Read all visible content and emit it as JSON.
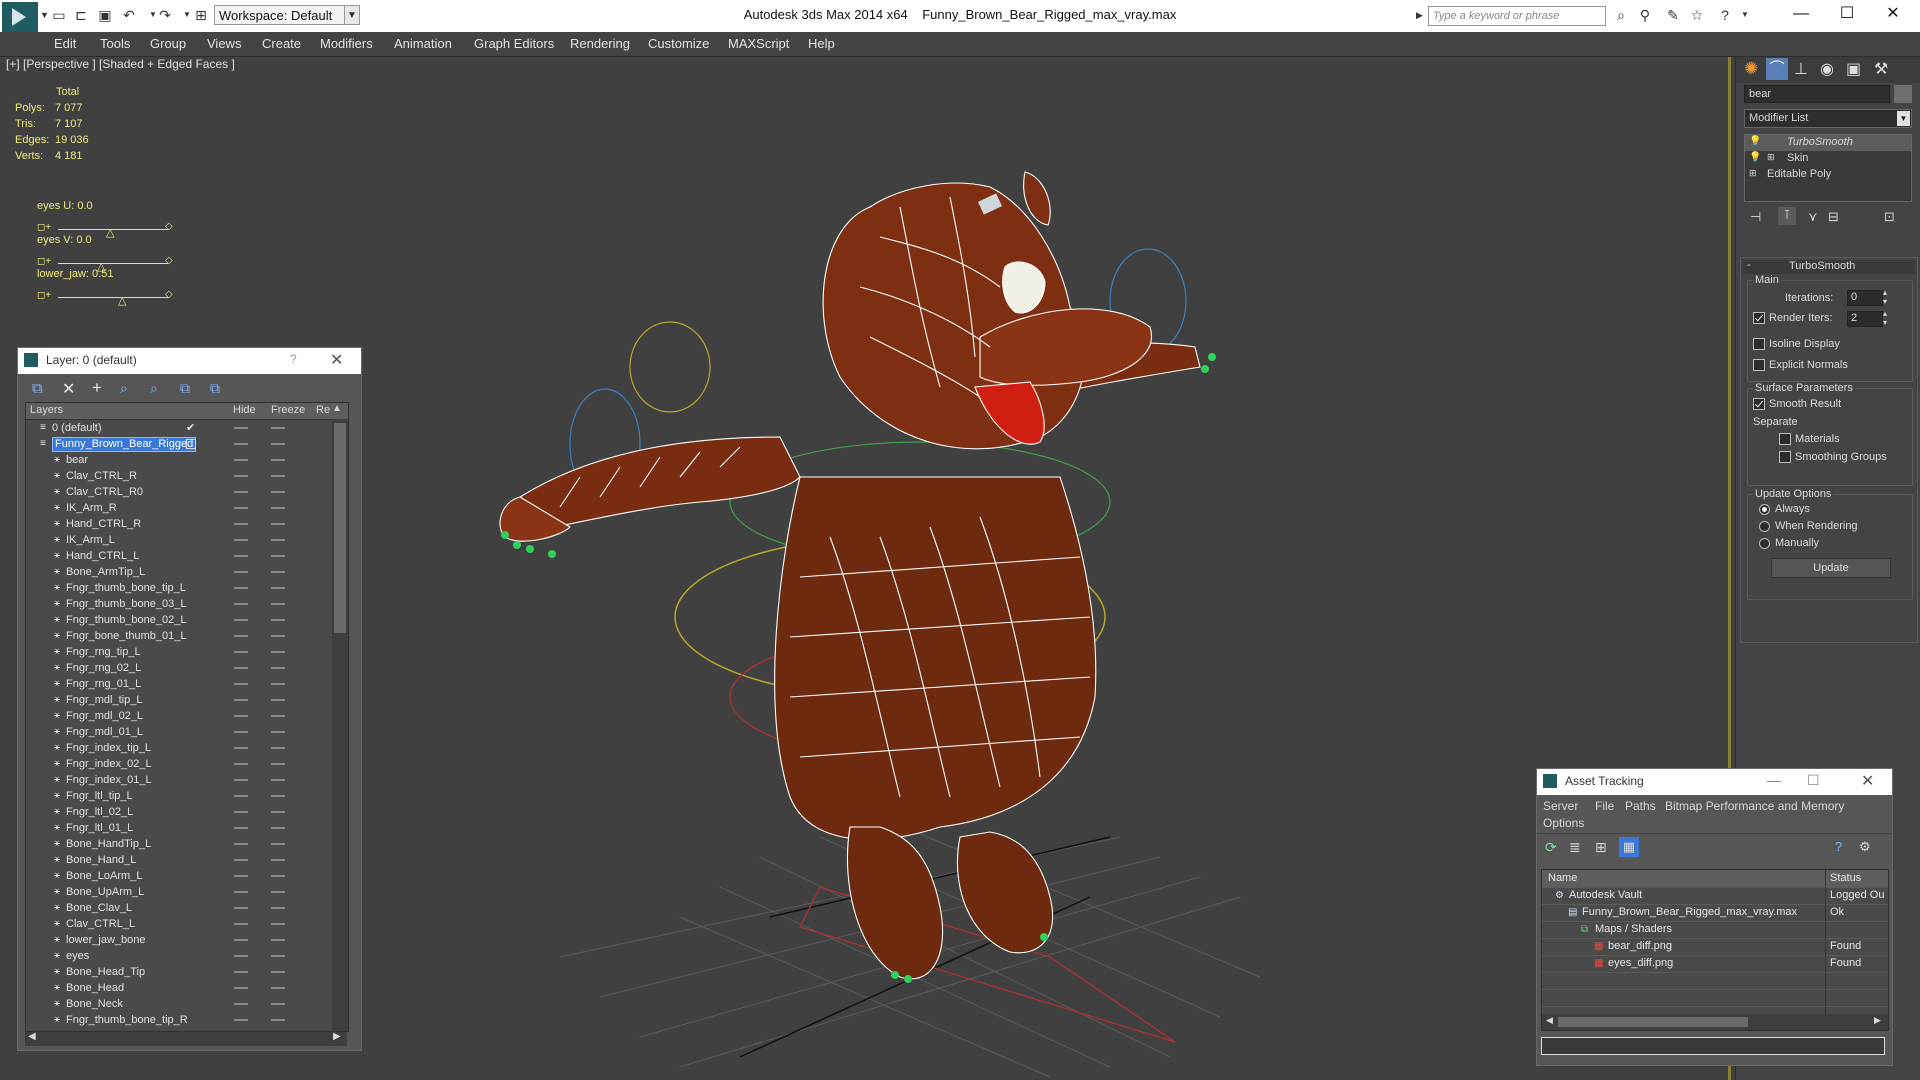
{
  "app": {
    "title": "Autodesk 3ds Max  2014 x64",
    "filename": "Funny_Brown_Bear_Rigged_max_vray.max",
    "workspace": "Workspace: Default",
    "search_placeholder": "Type a keyword or phrase"
  },
  "menu": [
    "Edit",
    "Tools",
    "Group",
    "Views",
    "Create",
    "Modifiers",
    "Animation",
    "Graph Editors",
    "Rendering",
    "Customize",
    "MAXScript",
    "Help"
  ],
  "viewport": {
    "label": "[+] [Perspective ] [Shaded + Edged Faces ]",
    "stats_header": "Total",
    "stats": [
      {
        "label": "Polys:",
        "value": "7 077"
      },
      {
        "label": "Tris:",
        "value": "7 107"
      },
      {
        "label": "Edges:",
        "value": "19 036"
      },
      {
        "label": "Verts:",
        "value": "4 181"
      }
    ],
    "sliders": [
      {
        "label": "eyes U: 0.0",
        "value": 0.0
      },
      {
        "label": "eyes V: 0.0",
        "value": 0.0
      },
      {
        "label": "lower_jaw: 0.51",
        "value": 0.51
      }
    ]
  },
  "layer_window": {
    "title": "Layer: 0 (default)",
    "help": "?",
    "columns": [
      "Layers",
      "Hide",
      "Freeze",
      "Re"
    ],
    "layers": [
      {
        "name": "0 (default)",
        "indent": 0,
        "checked": true
      },
      {
        "name": "Funny_Brown_Bear_Rigged",
        "indent": 0,
        "selected": true
      }
    ],
    "objects": [
      "bear",
      "Clav_CTRL_R",
      "Clav_CTRL_R0",
      "IK_Arm_R",
      "Hand_CTRL_R",
      "IK_Arm_L",
      "Hand_CTRL_L",
      "Bone_ArmTip_L",
      "Fngr_thumb_bone_tip_L",
      "Fngr_thumb_bone_03_L",
      "Fngr_thumb_bone_02_L",
      "Fngr_bone_thumb_01_L",
      "Fngr_rng_tip_L",
      "Fngr_rng_02_L",
      "Fngr_rng_01_L",
      "Fngr_mdl_tip_L",
      "Fngr_mdl_02_L",
      "Fngr_mdl_01_L",
      "Fngr_index_tip_L",
      "Fngr_index_02_L",
      "Fngr_index_01_L",
      "Fngr_ltl_tip_L",
      "Fngr_ltl_02_L",
      "Fngr_ltl_01_L",
      "Bone_HandTip_L",
      "Bone_Hand_L",
      "Bone_LoArm_L",
      "Bone_UpArm_L",
      "Bone_Clav_L",
      "Clav_CTRL_L",
      "lower_jaw_bone",
      "eyes",
      "Bone_Head_Tip",
      "Bone_Head",
      "Bone_Neck",
      "Fngr_thumb_bone_tip_R"
    ]
  },
  "command_panel": {
    "object_name": "bear",
    "modifier_list": "Modifier List",
    "stack": [
      "TurboSmooth",
      "Skin",
      "Editable Poly"
    ],
    "rollout_title": "TurboSmooth",
    "main_label": "Main",
    "iterations_label": "Iterations:",
    "iterations_value": "0",
    "render_iters_label": "Render Iters:",
    "render_iters_value": "2",
    "isoline": "Isoline Display",
    "explicit_normals": "Explicit Normals",
    "surface_params": "Surface Parameters",
    "smooth_result": "Smooth Result",
    "separate": "Separate",
    "materials": "Materials",
    "smoothing_groups": "Smoothing Groups",
    "update_options": "Update Options",
    "always": "Always",
    "when_rendering": "When Rendering",
    "manually": "Manually",
    "update_btn": "Update"
  },
  "asset_window": {
    "title": "Asset Tracking",
    "menu": [
      "Server",
      "File",
      "Paths",
      "Bitmap Performance and Memory"
    ],
    "menu2": "Options",
    "columns": [
      "Name",
      "Status"
    ],
    "rows": [
      {
        "name": "Autodesk Vault",
        "status": "Logged Ou",
        "indent": 1
      },
      {
        "name": "Funny_Brown_Bear_Rigged_max_vray.max",
        "status": "Ok",
        "indent": 2
      },
      {
        "name": "Maps / Shaders",
        "status": "",
        "indent": 3
      },
      {
        "name": "bear_diff.png",
        "status": "Found",
        "indent": 4
      },
      {
        "name": "eyes_diff.png",
        "status": "Found",
        "indent": 4
      }
    ]
  },
  "colors": {
    "bear": "#7a2c10",
    "wire": "#ffffff",
    "stat_text": "#f2ea7c",
    "selection": "#3a78d8"
  }
}
